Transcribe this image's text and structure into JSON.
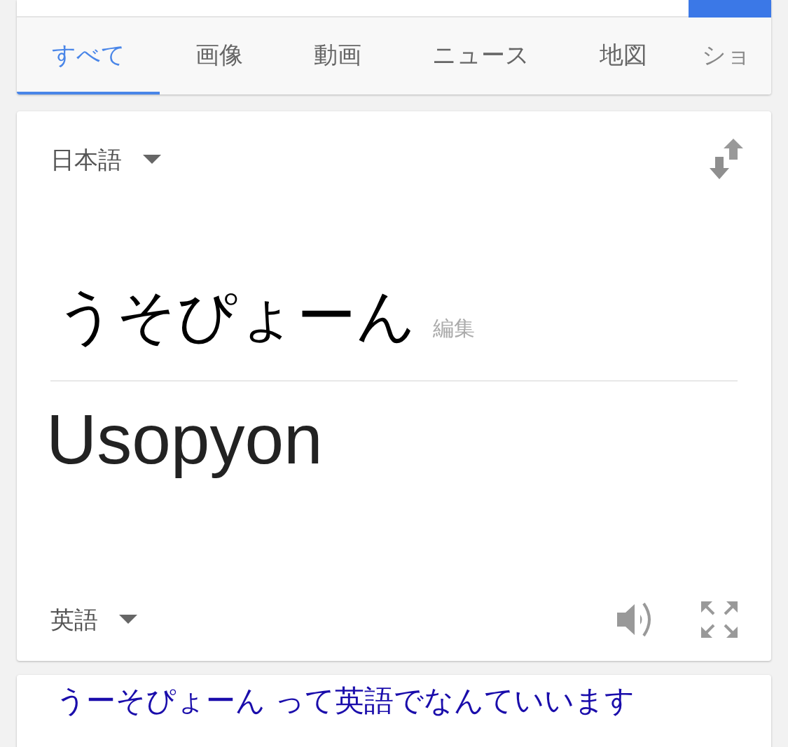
{
  "tabs": [
    {
      "label": "すべて",
      "selected": true
    },
    {
      "label": "画像",
      "selected": false
    },
    {
      "label": "動画",
      "selected": false
    },
    {
      "label": "ニュース",
      "selected": false
    },
    {
      "label": "地図",
      "selected": false
    },
    {
      "label": "ショ",
      "selected": false
    }
  ],
  "translator": {
    "source_language": "日本語",
    "source_text": "うそぴょーん",
    "edit_label": "編集",
    "translation": "Usopyon",
    "target_language": "英語"
  },
  "result": {
    "title": "うーそぴょーん って英語でなんていいます"
  }
}
